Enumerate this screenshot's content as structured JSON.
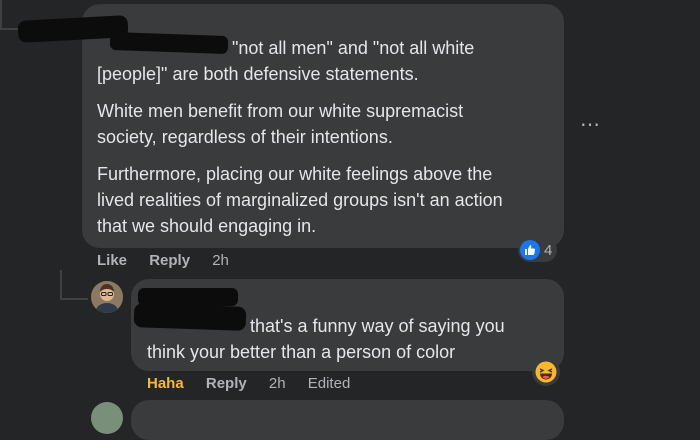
{
  "comment1": {
    "mention_text": "\"not all men\" and \"not all white",
    "line2": "[people]\" are both defensive statements.",
    "para2_line1": "White men benefit from our white supremacist",
    "para2_line2": "society, regardless of their intentions.",
    "para3_line1": "Furthermore, placing our white feelings above the",
    "para3_line2": "lived realities of marginalized groups isn't an action",
    "para3_line3": "that we should engaging in.",
    "like_label": "Like",
    "reply_label": "Reply",
    "time": "2h",
    "reaction_icon": "like-icon",
    "reaction_count": "4",
    "reaction_color": "#1877f2"
  },
  "comment2": {
    "line1": "that's a funny way of saying you",
    "line2": "think your better than a person of color",
    "reacted_label": "Haha",
    "reacted_color": "#f7b928",
    "reply_label": "Reply",
    "time": "2h",
    "edited_label": "Edited",
    "reaction_icon": "haha-icon"
  },
  "more_icon": "more-icon",
  "more_glyph": "⋯"
}
